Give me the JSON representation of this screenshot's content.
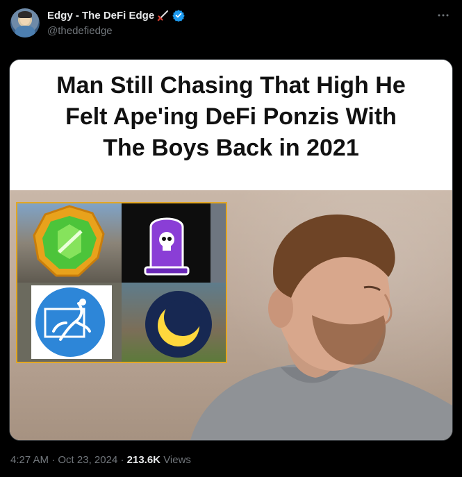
{
  "tweet": {
    "author_name": "Edgy - The DeFi Edge",
    "author_handle": "@thedefiedge",
    "icons": [
      "sword-icon",
      "verified-icon",
      "more-icon"
    ],
    "verified_color": "#1d9bf0"
  },
  "media": {
    "headline_lines": [
      "Man Still Chasing That High He",
      "Felt Ape'ing DeFi Ponzis With",
      "The Boys Back in 2021"
    ],
    "grid_icons": [
      "green-gem-coin-icon",
      "tombstone-skull-icon",
      "falling-man-coin-icon",
      "luna-moon-coin-icon"
    ]
  },
  "footer": {
    "time": "4:27 AM",
    "separator": "·",
    "date": "Oct 23, 2024",
    "views_count": "213.6K",
    "views_label": "Views"
  }
}
